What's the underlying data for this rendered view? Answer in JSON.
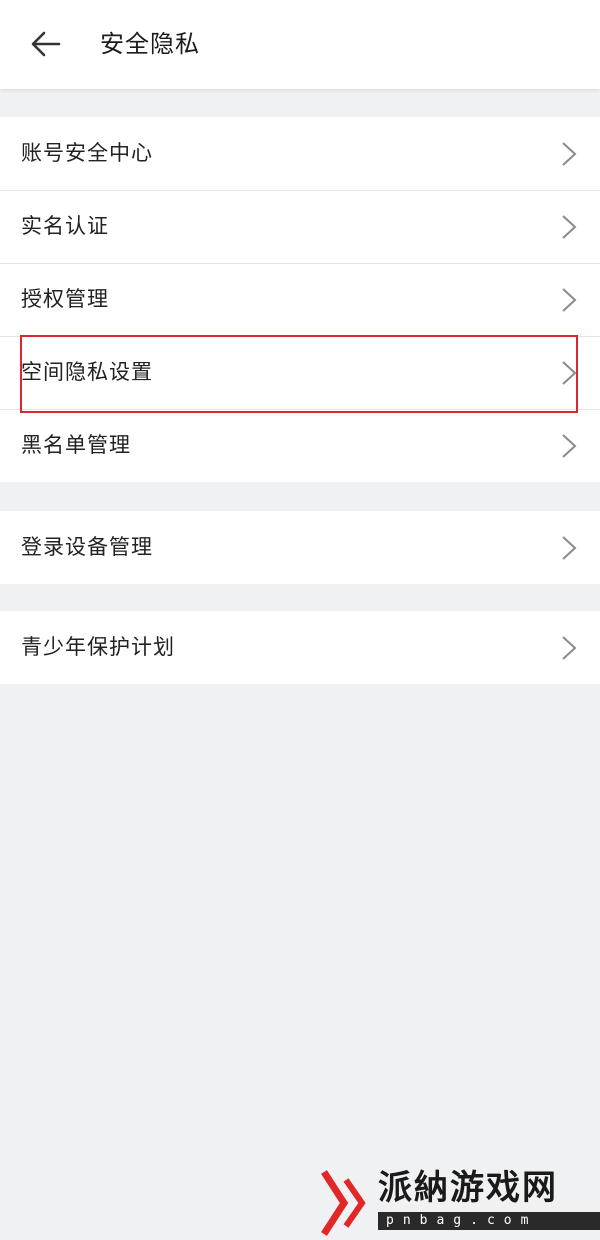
{
  "header": {
    "title": "安全隐私",
    "back_icon": "arrow-left-icon"
  },
  "groups": [
    {
      "items": [
        {
          "label": "账号安全中心"
        },
        {
          "label": "实名认证"
        },
        {
          "label": "授权管理"
        },
        {
          "label": "空间隐私设置",
          "highlighted": true
        },
        {
          "label": "黑名单管理"
        }
      ]
    },
    {
      "items": [
        {
          "label": "登录设备管理"
        }
      ]
    },
    {
      "items": [
        {
          "label": "青少年保护计划"
        }
      ]
    }
  ],
  "chevron_icon": "chevron-right-icon",
  "colors": {
    "background": "#f0f1f3",
    "card": "#ffffff",
    "highlight_border": "#d8282e",
    "text": "#222222"
  },
  "watermark": {
    "text": "派納游戏网",
    "url": "pnbag.com"
  }
}
